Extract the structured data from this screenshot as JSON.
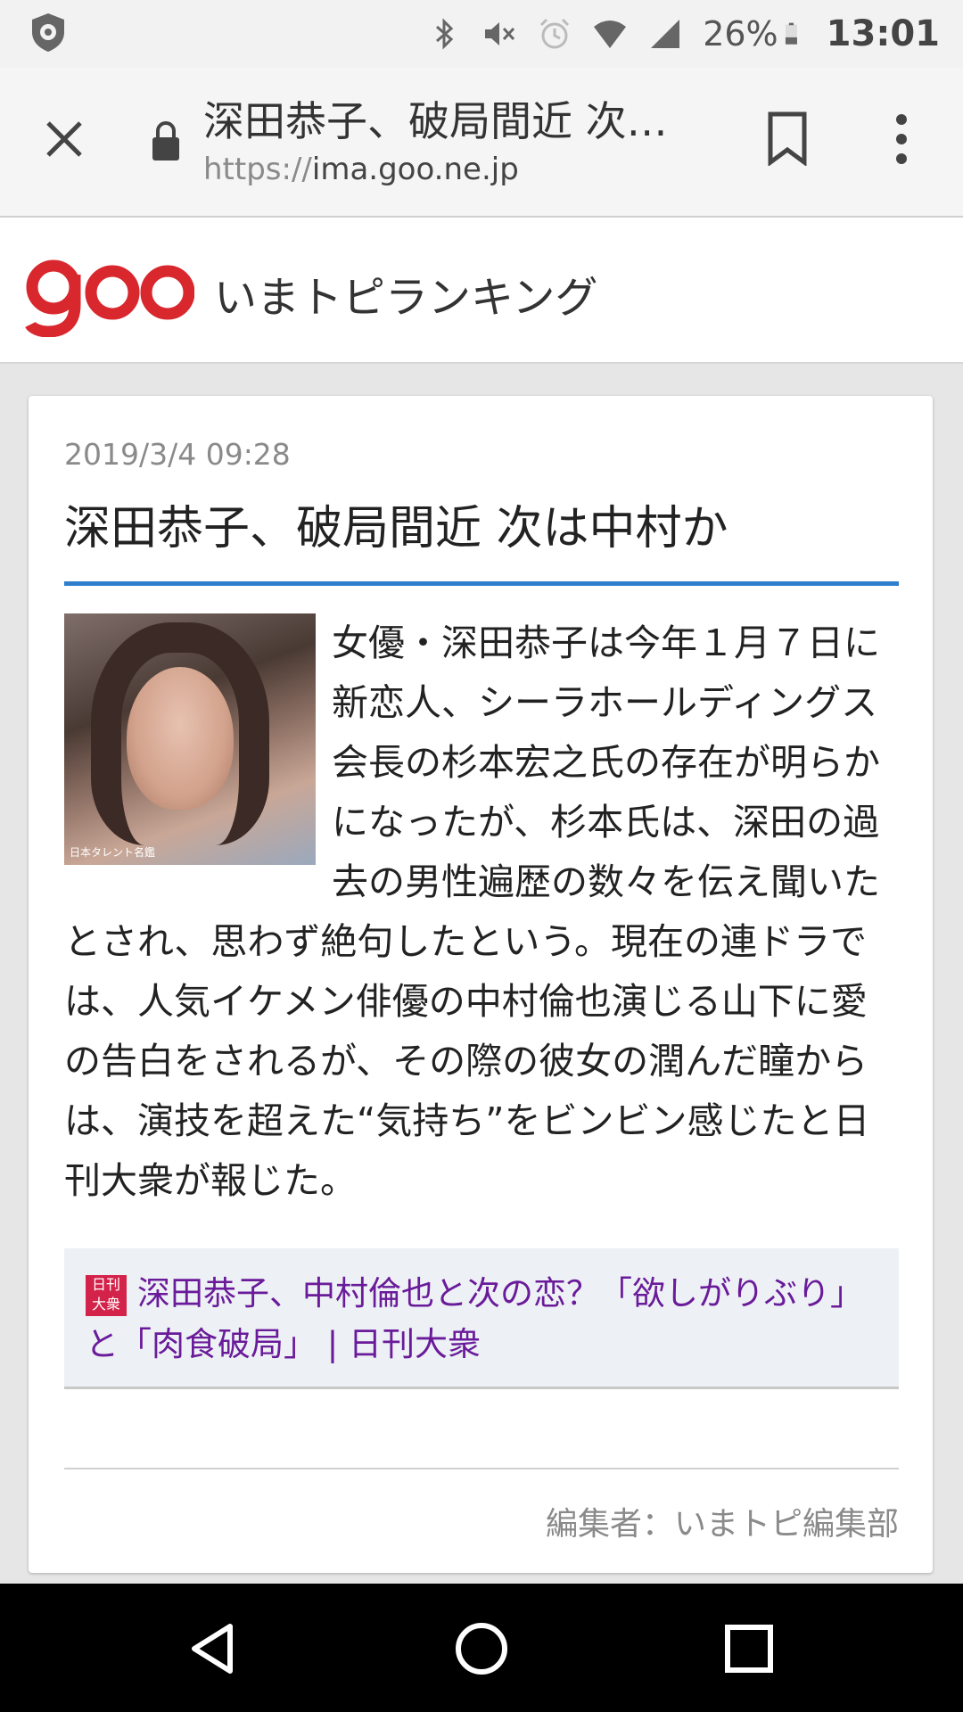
{
  "status_bar": {
    "battery_percent": "26%",
    "time": "13:01",
    "icons": [
      "shield-icon",
      "bluetooth-icon",
      "mute-icon",
      "alarm-icon",
      "wifi-icon",
      "signal-icon",
      "battery-icon"
    ]
  },
  "browser": {
    "page_title": "深田恭子、破局間近 次…",
    "url_scheme": "https://",
    "url_host": "ima.goo.ne.jp"
  },
  "site": {
    "logo_text": "goo",
    "title": "いまトピランキング",
    "brand_color": "#d9272e"
  },
  "article": {
    "date": "2019/3/4 09:28",
    "headline": "深田恭子、破局間近 次は中村か",
    "photo_caption": "日本タレント名鑑",
    "body": "女優・深田恭子は今年１月７日に新恋人、シーラホールディングス会長の杉本宏之氏の存在が明らかになったが、杉本氏は、深田の過去の男性遍歴の数々を伝え聞いたとされ、思わず絶句したという。現在の連ドラでは、人気イケメン俳優の中村倫也演じる山下に愛の告白をされるが、その際の彼女の潤んだ瞳からは、演技を超えた“気持ち”をビンビン感じたと日刊大衆が報じた。",
    "related_icon_text": "日刊大衆",
    "related_link": "深田恭子、中村倫也と次の恋？「欲しがりぶり」と「肉食破局」 | 日刊大衆",
    "editor": "編集者：いまトピ編集部",
    "accent_color": "#2f7fcd"
  },
  "nav": {
    "buttons": [
      "back-icon",
      "home-icon",
      "recents-icon"
    ]
  }
}
